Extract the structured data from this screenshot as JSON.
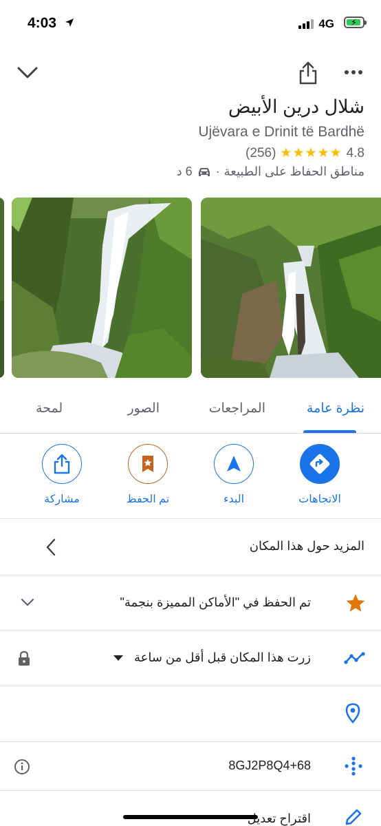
{
  "status_bar": {
    "time": "4:03",
    "network": "4G"
  },
  "header": {
    "collapse_icon": "chevron-down-icon",
    "share_icon": "share-icon",
    "more_icon": "more-horizontal-icon"
  },
  "place": {
    "title": "شلال درين الأبيض",
    "subtitle": "Ujëvara e Drinit të Bardhë",
    "rating": "4.8",
    "stars": "★★★★★",
    "review_count": "(256)",
    "category": "مناطق الحفاظ على الطبيعة",
    "separator": "·",
    "travel_time": "6 د"
  },
  "tabs": [
    {
      "label": "نظرة عامة",
      "active": true
    },
    {
      "label": "المراجعات",
      "active": false
    },
    {
      "label": "الصور",
      "active": false
    },
    {
      "label": "لمحة",
      "active": false
    }
  ],
  "actions": [
    {
      "label": "الاتجاهات",
      "icon": "directions-icon"
    },
    {
      "label": "البدء",
      "icon": "navigation-arrow-icon"
    },
    {
      "label": "تم الحفظ",
      "icon": "saved-bookmark-icon"
    },
    {
      "label": "مشاركة",
      "icon": "share-icon"
    }
  ],
  "rows": {
    "more_about": "المزيد حول هذا المكان",
    "saved_in": "تم الحفظ في \"الأماكن المميزة بنجمة\"",
    "visited": "زرت هذا المكان قبل أقل من ساعة",
    "plus_code": "8GJ2P8Q4+68",
    "suggest_edit": "اقتراح تعديل"
  },
  "colors": {
    "accent": "#1a73e8",
    "star": "#fbbc04",
    "saved_orange": "#e37400"
  }
}
